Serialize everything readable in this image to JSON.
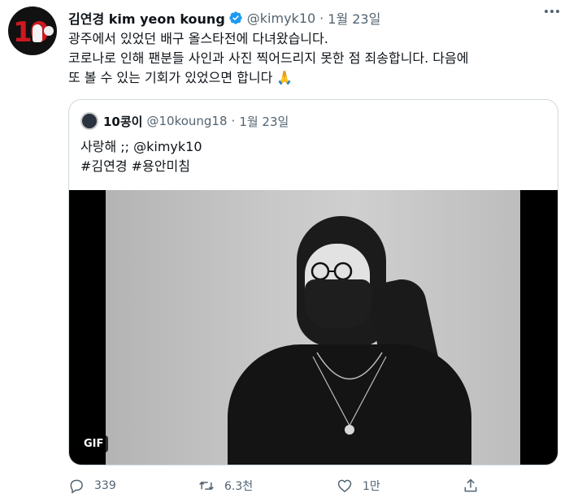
{
  "tweet": {
    "display_name": "김연경 kim yeon koung",
    "handle": "@kimyk10",
    "separator": "·",
    "date": "1월 23일",
    "text_lines": [
      "광주에서 있었던 배구 올스타전에 다녀왔습니다.",
      "코로나로 인해 팬분들 사인과 사진 찍어드리지 못한 점 죄송합니다. 다음에",
      "또 볼 수 있는 기회가 있었으면 합니다"
    ],
    "emoji": "🙏",
    "avatar_text": "10"
  },
  "quote": {
    "display_name": "10콩이",
    "handle": "@10koung18",
    "separator": "·",
    "date": "1월 23일",
    "text_lines": [
      "사랑해 ;; @kimyk10",
      "#김연경 #용안미침"
    ],
    "media_badge": "GIF"
  },
  "actions": {
    "reply_count": "339",
    "retweet_count": "6.3천",
    "like_count": "1만"
  },
  "icons": [
    "more-icon",
    "verified-icon",
    "reply-icon",
    "retweet-icon",
    "like-icon",
    "share-icon"
  ],
  "colors": {
    "verified": "#1d9bf0",
    "muted": "#536471",
    "border": "#cfd9de"
  }
}
